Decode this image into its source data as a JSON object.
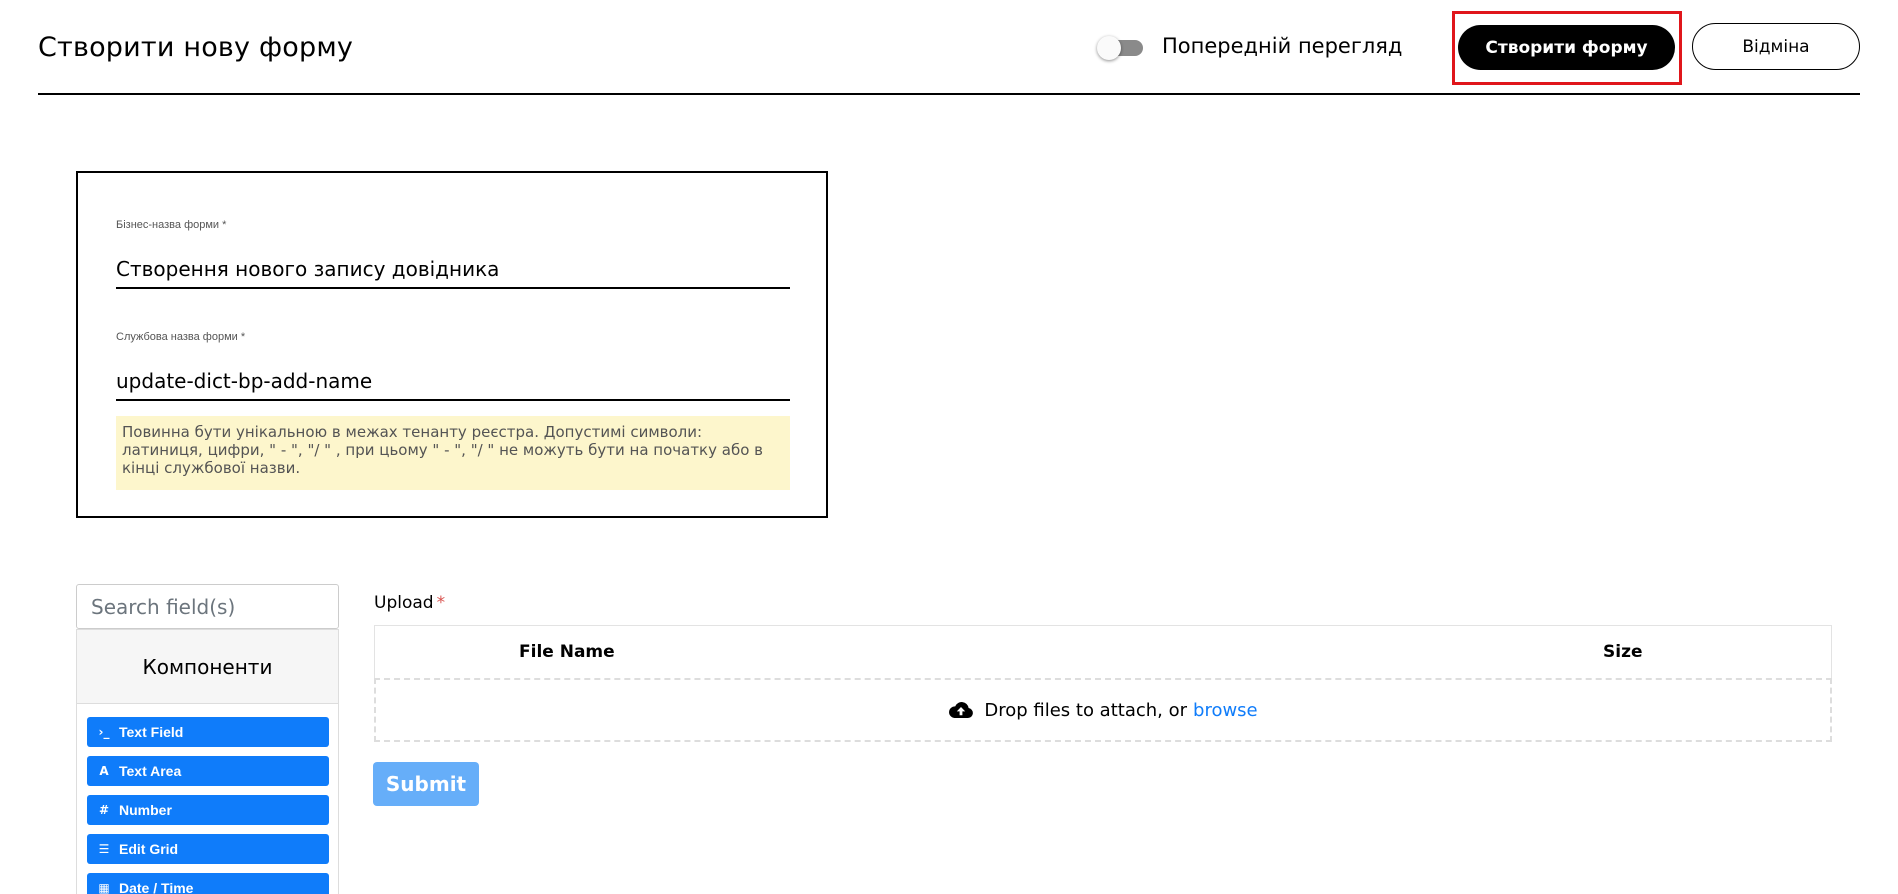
{
  "header": {
    "title": "Створити нову форму",
    "preview_label": "Попередній перегляд",
    "create_button": "Створити форму",
    "cancel_button": "Відміна"
  },
  "form": {
    "business_name_label": "Бізнес-назва форми *",
    "business_name_value": "Створення нового запису довідника",
    "service_name_label": "Службова назва форми *",
    "service_name_value": "update-dict-bp-add-name",
    "hint": "Повинна бути унікальною в межах тенанту реєстра. Допустимі символи: латиниця, цифри, \" - \", \"/ \" , при цьому  \" - \", \"/ \" не можуть бути на початку або в кінці службової назви."
  },
  "builder": {
    "search_placeholder": "Search field(s)",
    "components_title": "Компоненти",
    "components": [
      {
        "label": "Text Field",
        "icon": "terminal-icon"
      },
      {
        "label": "Text Area",
        "icon": "font-icon"
      },
      {
        "label": "Number",
        "icon": "hash-icon"
      },
      {
        "label": "Edit Grid",
        "icon": "list-icon"
      },
      {
        "label": "Date / Time",
        "icon": "calendar-icon"
      }
    ]
  },
  "upload": {
    "label": "Upload",
    "required_mark": "*",
    "col_file_name": "File Name",
    "col_size": "Size",
    "drop_text": "Drop files to attach, or",
    "browse_text": "browse",
    "submit": "Submit"
  },
  "colors": {
    "accent": "#0f7cfa",
    "highlight": "#e0161b",
    "hint_bg": "#fdf6cc",
    "submit_bg": "#66aef9"
  }
}
